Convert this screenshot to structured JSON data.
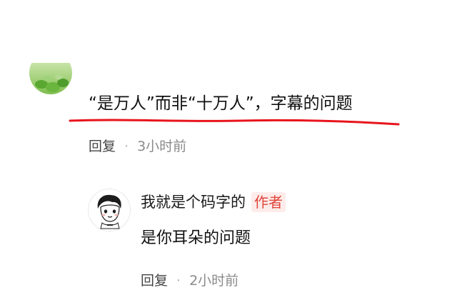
{
  "comment": {
    "text": "“是万人”而非“十万人”，字幕的问题",
    "reply_label": "回复",
    "separator": "·",
    "time": "3小时前"
  },
  "reply": {
    "author": "我就是个码字的",
    "badge": "作者",
    "text": "是你耳朵的问题",
    "reply_label": "回复",
    "separator": "·",
    "time": "2小时前"
  },
  "colors": {
    "underline": "#e8141c",
    "badge_bg": "#fdecea",
    "badge_text": "#e0453a",
    "meta_time": "#8a8a8a"
  }
}
